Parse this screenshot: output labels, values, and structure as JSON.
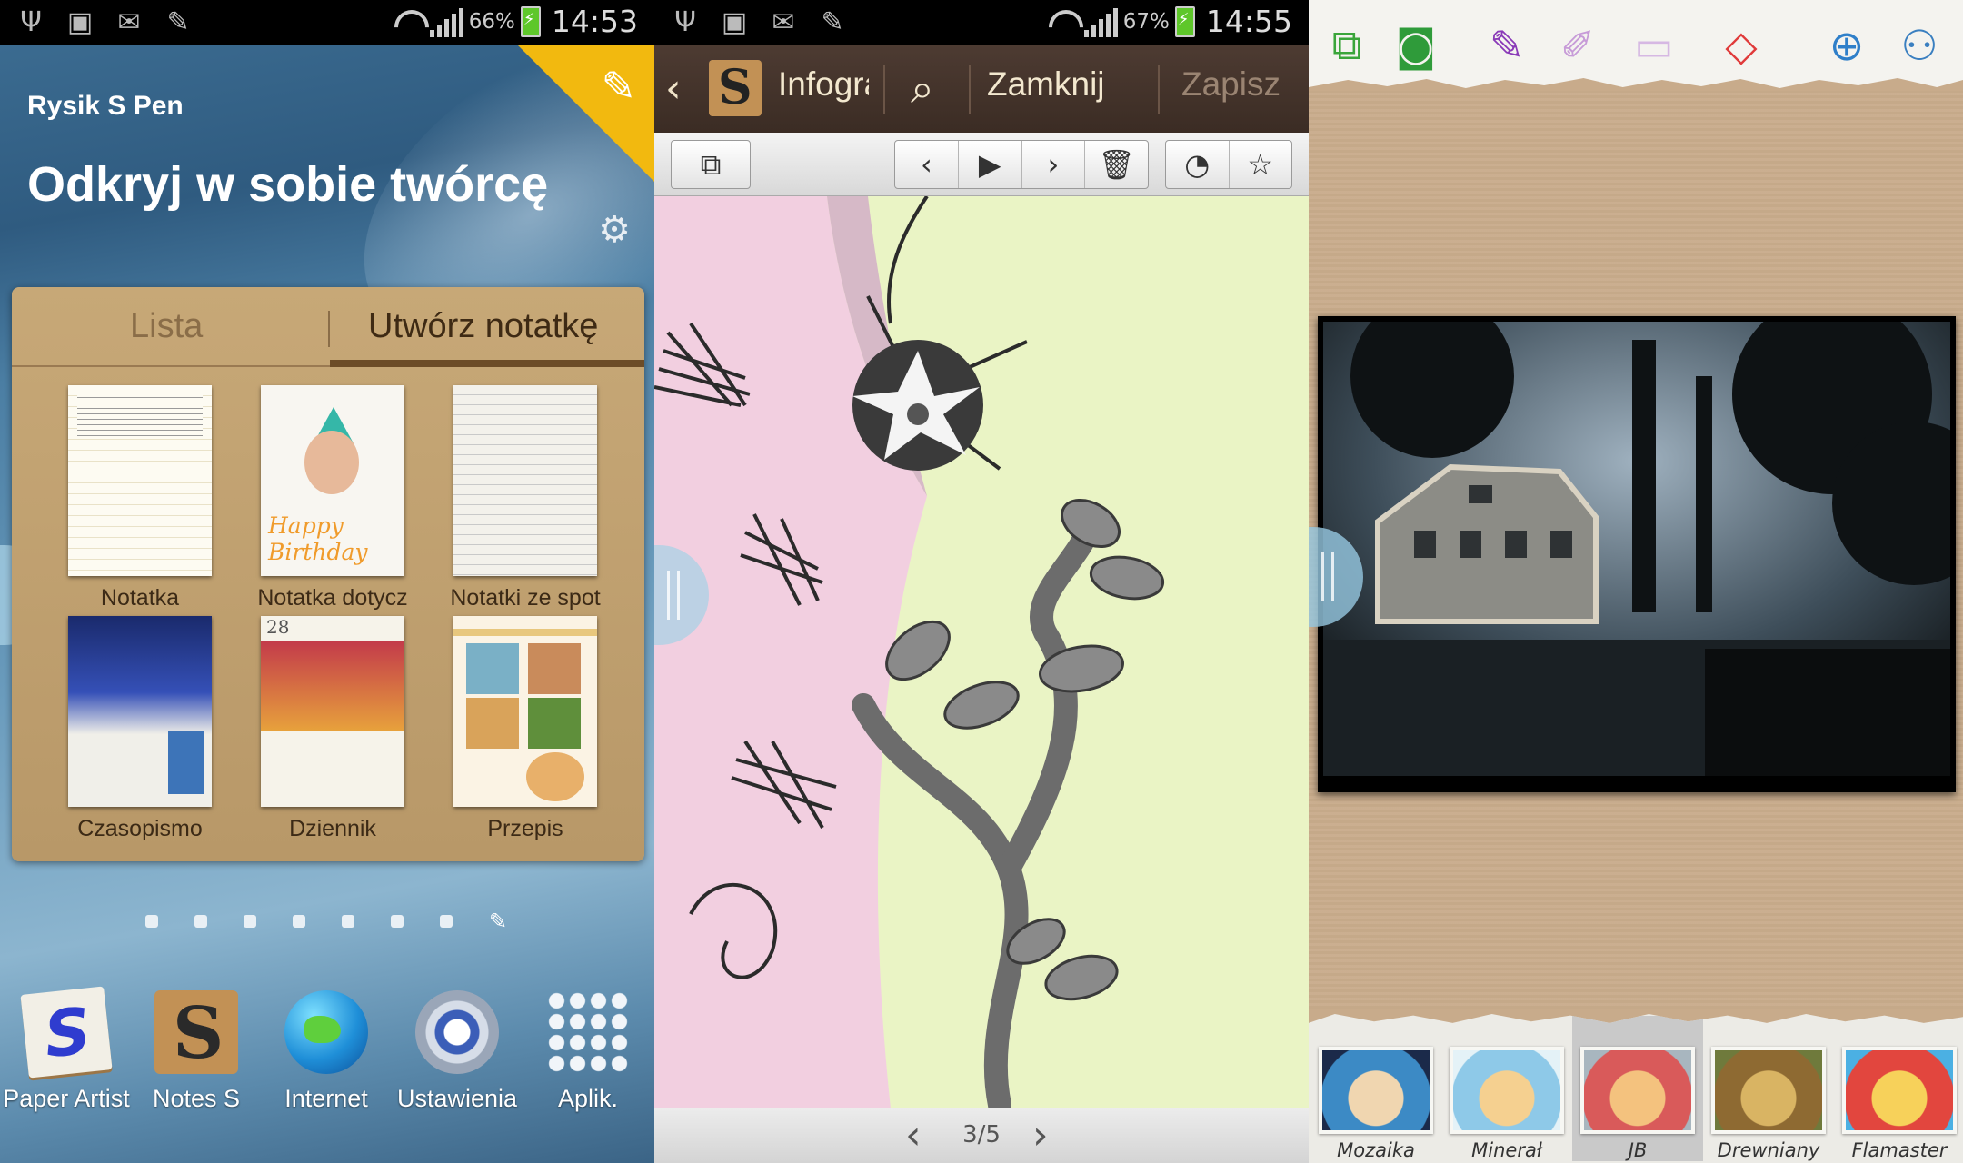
{
  "panel1": {
    "status": {
      "battery": "66%",
      "time": "14:53"
    },
    "widget": {
      "subtitle": "Rysik S Pen",
      "title": "Odkryj w sobie twórcę",
      "tabs": {
        "list": "Lista",
        "create": "Utwórz notatkę"
      },
      "templates": [
        {
          "label": "Notatka"
        },
        {
          "label": "Notatka dotycz"
        },
        {
          "label": "Notatki ze spot"
        },
        {
          "label": "Czasopismo"
        },
        {
          "label": "Dziennik"
        },
        {
          "label": "Przepis"
        }
      ],
      "birthday_text": "Happy Birthday"
    },
    "page_indicator": {
      "pages": 7,
      "current": 0
    },
    "dock": [
      {
        "label": "Paper Artist",
        "icon": "paper-artist-icon"
      },
      {
        "label": "Notes S",
        "icon": "notes-s-icon"
      },
      {
        "label": "Internet",
        "icon": "globe-icon"
      },
      {
        "label": "Ustawienia",
        "icon": "settings-cog-icon"
      },
      {
        "label": "Aplik.",
        "icon": "apps-grid-icon"
      }
    ]
  },
  "panel2": {
    "status": {
      "battery": "67%",
      "time": "14:55"
    },
    "topbar": {
      "title": "Infogra",
      "close": "Zamknij",
      "save": "Zapisz"
    },
    "page": "3/5"
  },
  "panel3": {
    "filters": [
      {
        "label": "Mozaika"
      },
      {
        "label": "Minerał"
      },
      {
        "label": "JB"
      },
      {
        "label": "Drewniany"
      },
      {
        "label": "Flamaster"
      }
    ],
    "selected_filter": "JB"
  }
}
